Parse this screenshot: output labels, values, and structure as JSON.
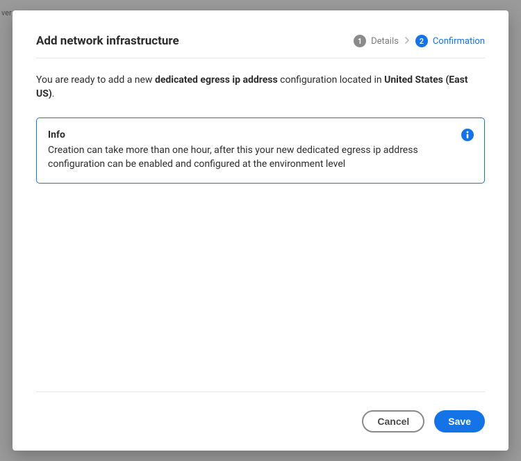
{
  "backdrop_hint": "ver",
  "header": {
    "title": "Add network infrastructure",
    "steps": {
      "step1": {
        "num": "1",
        "label": "Details"
      },
      "step2": {
        "num": "2",
        "label": "Confirmation"
      }
    }
  },
  "intro": {
    "prefix": "You are ready to add a new ",
    "config_type": "dedicated egress ip address",
    "middle": " configuration located in ",
    "region": "United States (East US)",
    "suffix": "."
  },
  "info": {
    "title": "Info",
    "body": "Creation can take more than one hour, after this your new dedicated egress ip address configuration can be enabled and configured at the environment level"
  },
  "footer": {
    "cancel": "Cancel",
    "save": "Save"
  }
}
